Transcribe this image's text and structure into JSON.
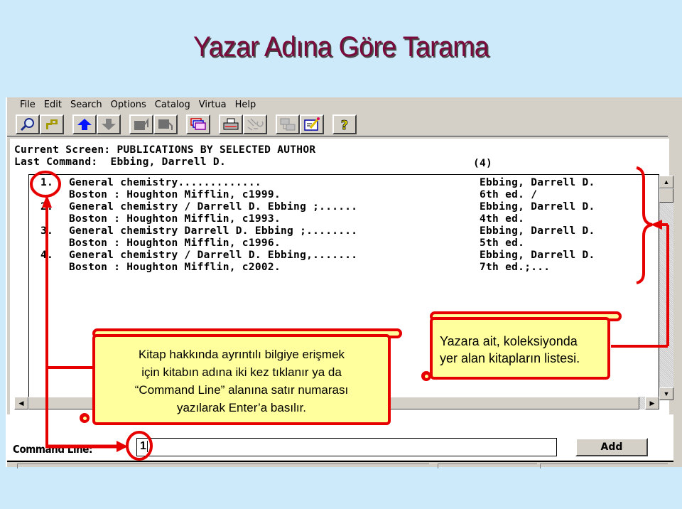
{
  "slide": {
    "title": "Yazar Adına Göre Tarama"
  },
  "menu": {
    "items": [
      "File",
      "Edit",
      "Search",
      "Options",
      "Catalog",
      "Virtua",
      "Help"
    ]
  },
  "toolbar": {
    "buttons": [
      {
        "icon": "search-magnifier-icon"
      },
      {
        "icon": "key-icon"
      },
      {
        "icon": "arrow-up-icon"
      },
      {
        "icon": "arrow-down-icon"
      },
      {
        "icon": "export-icon"
      },
      {
        "icon": "import-icon"
      },
      {
        "icon": "stacked-windows-icon"
      },
      {
        "icon": "printer-icon"
      },
      {
        "icon": "circuit-icon"
      },
      {
        "icon": "transfer-icon"
      },
      {
        "icon": "edit-record-icon"
      },
      {
        "icon": "help-question-icon"
      }
    ]
  },
  "screen": {
    "current_screen": "Current Screen: PUBLICATIONS BY SELECTED AUTHOR",
    "last_command": "Last Command:  Ebbing, Darrell D.",
    "count": "(4)"
  },
  "results": [
    {
      "number": "1.",
      "title_line": "General chemistry.............",
      "author": "Ebbing, Darrell D.",
      "publisher_line": "Boston : Houghton Mifflin, c1999.",
      "edition": "6th ed. /"
    },
    {
      "number": "2.",
      "title_line": "General chemistry / Darrell D. Ebbing ;......",
      "author": "Ebbing, Darrell D.",
      "publisher_line": "Boston : Houghton Mifflin, c1993.",
      "edition": "4th ed."
    },
    {
      "number": "3.",
      "title_line": "General chemistry Darrell D. Ebbing ;........",
      "author": "Ebbing, Darrell D.",
      "publisher_line": "Boston : Houghton Mifflin, c1996.",
      "edition": "5th ed."
    },
    {
      "number": "4.",
      "title_line": "General chemistry / Darrell D. Ebbing,.......",
      "author": "Ebbing, Darrell D.",
      "publisher_line": "Boston : Houghton Mifflin, c2002.",
      "edition": "7th ed.;..."
    }
  ],
  "command_line": {
    "label": "Command Line:",
    "value": "1",
    "add_button": "Add"
  },
  "callouts": {
    "left": {
      "lines": [
        "Kitap hakkında ayrıntılı bilgiye erişmek",
        "için kitabın adına iki kez tıklanır ya da",
        "“Command Line” alanına satır numarası",
        "yazılarak Enter’a basılır."
      ]
    },
    "right": {
      "lines": [
        "Yazara ait, koleksiyonda",
        "yer alan kitapların listesi."
      ]
    }
  },
  "colors": {
    "background": "#cdeafb",
    "title": "#7a0a3c",
    "annotation_red": "#e60000",
    "callout_fill": "#ffff9e",
    "window_gray": "#d4d0c8"
  }
}
